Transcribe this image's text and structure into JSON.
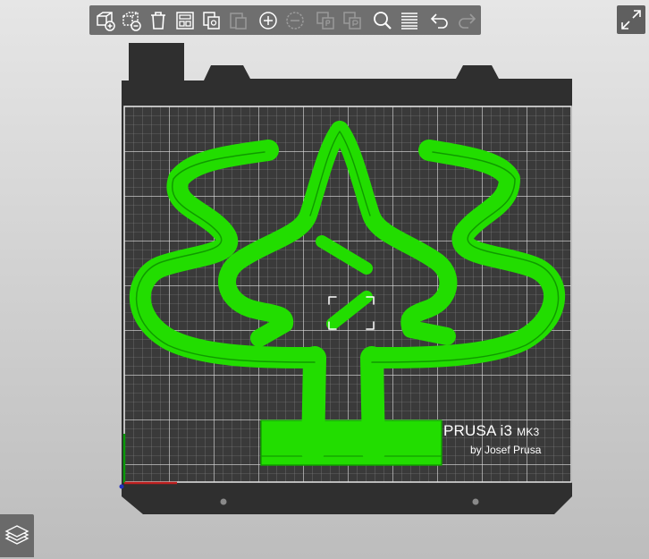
{
  "toolbar": {
    "buttons": [
      {
        "id": "add",
        "label": "add-object"
      },
      {
        "id": "delete",
        "label": "delete-object"
      },
      {
        "id": "delete-all",
        "label": "delete-all"
      },
      {
        "id": "arrange",
        "label": "arrange"
      },
      {
        "id": "copy",
        "label": "copy"
      },
      {
        "id": "paste",
        "label": "paste"
      },
      {
        "id": "add-instance",
        "label": "add-instance"
      },
      {
        "id": "remove-instance",
        "label": "remove-instance"
      },
      {
        "id": "split-objects",
        "label": "split-objects"
      },
      {
        "id": "split-parts",
        "label": "split-parts"
      },
      {
        "id": "search",
        "label": "search"
      },
      {
        "id": "layers-editing",
        "label": "layers-editing"
      },
      {
        "id": "undo",
        "label": "undo"
      },
      {
        "id": "redo",
        "label": "redo"
      }
    ]
  },
  "bed": {
    "brand": "PRUSA i3",
    "model_suffix": "MK3",
    "byline": "by Josef Prusa"
  },
  "colors": {
    "bed": "#2f2f2f",
    "grid": "#d9d9d9",
    "model": "#22dd00",
    "model_dark": "#109a00",
    "toolbar": "#6f6f6f",
    "icon": "#ffffff"
  }
}
